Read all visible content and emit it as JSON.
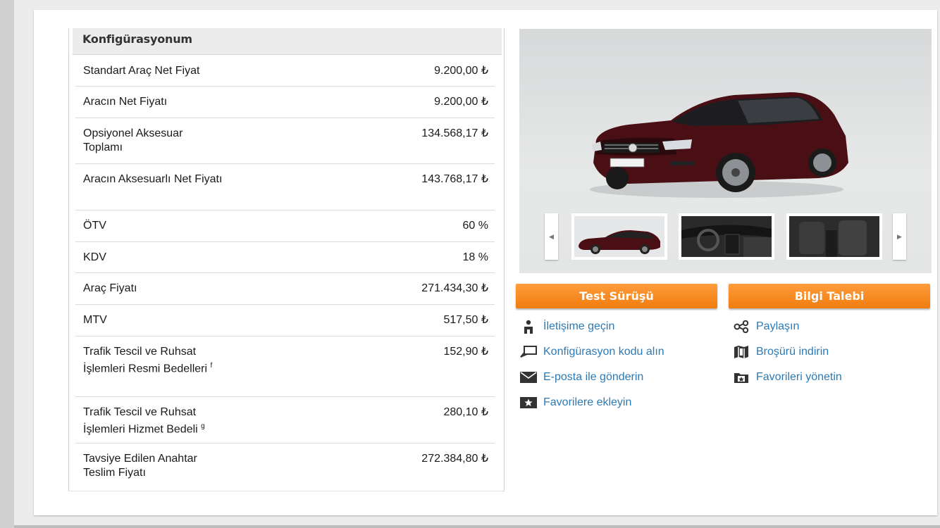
{
  "config": {
    "title": "Konfigürasyonum",
    "rows": [
      {
        "label": "Standart Araç Net Fiyat",
        "value": "9.200,00 ₺",
        "note": ""
      },
      {
        "label": "Aracın Net Fiyatı",
        "value": "9.200,00 ₺",
        "note": ""
      },
      {
        "label": "Opsiyonel Aksesuar Toplamı",
        "value": "134.568,17 ₺",
        "note": ""
      },
      {
        "label": "Aracın Aksesuarlı Net Fiyatı",
        "value": "143.768,17 ₺",
        "note": ""
      },
      {
        "label": "ÖTV",
        "value": "60 %",
        "note": ""
      },
      {
        "label": "KDV",
        "value": "18 %",
        "note": ""
      },
      {
        "label": "Araç Fiyatı",
        "value": "271.434,30 ₺",
        "note": ""
      },
      {
        "label": "MTV",
        "value": "517,50 ₺",
        "note": ""
      },
      {
        "label": "Trafik Tescil ve Ruhsat İşlemleri Resmi Bedelleri",
        "value": "152,90 ₺",
        "note": "f"
      },
      {
        "label": "Trafik Tescil ve Ruhsat İşlemleri Hizmet Bedeli",
        "value": "280,10 ₺",
        "note": "g"
      },
      {
        "label": "Tavsiye Edilen Anahtar Teslim Fiyatı",
        "value": "272.384,80 ₺",
        "note": ""
      }
    ]
  },
  "gallery": {
    "car_color": "#4a0f14",
    "thumbs": [
      "exterior-side",
      "interior-dashboard",
      "interior-seats"
    ]
  },
  "actions": {
    "test_drive": "Test Sürüşü",
    "info_request": "Bilgi Talebi",
    "accent": "#f5841f"
  },
  "links": [
    {
      "icon": "person-icon",
      "label": "İletişime geçin"
    },
    {
      "icon": "share-icon",
      "label": "Paylaşın"
    },
    {
      "icon": "code-bubble-icon",
      "label": "Konfigürasyon kodu alın"
    },
    {
      "icon": "brochure-icon",
      "label": "Broşürü indirin"
    },
    {
      "icon": "envelope-icon",
      "label": "E-posta ile gönderin"
    },
    {
      "icon": "folder-star-icon",
      "label": "Favorileri yönetin"
    },
    {
      "icon": "star-folder-add-icon",
      "label": "Favorilere ekleyin"
    }
  ]
}
